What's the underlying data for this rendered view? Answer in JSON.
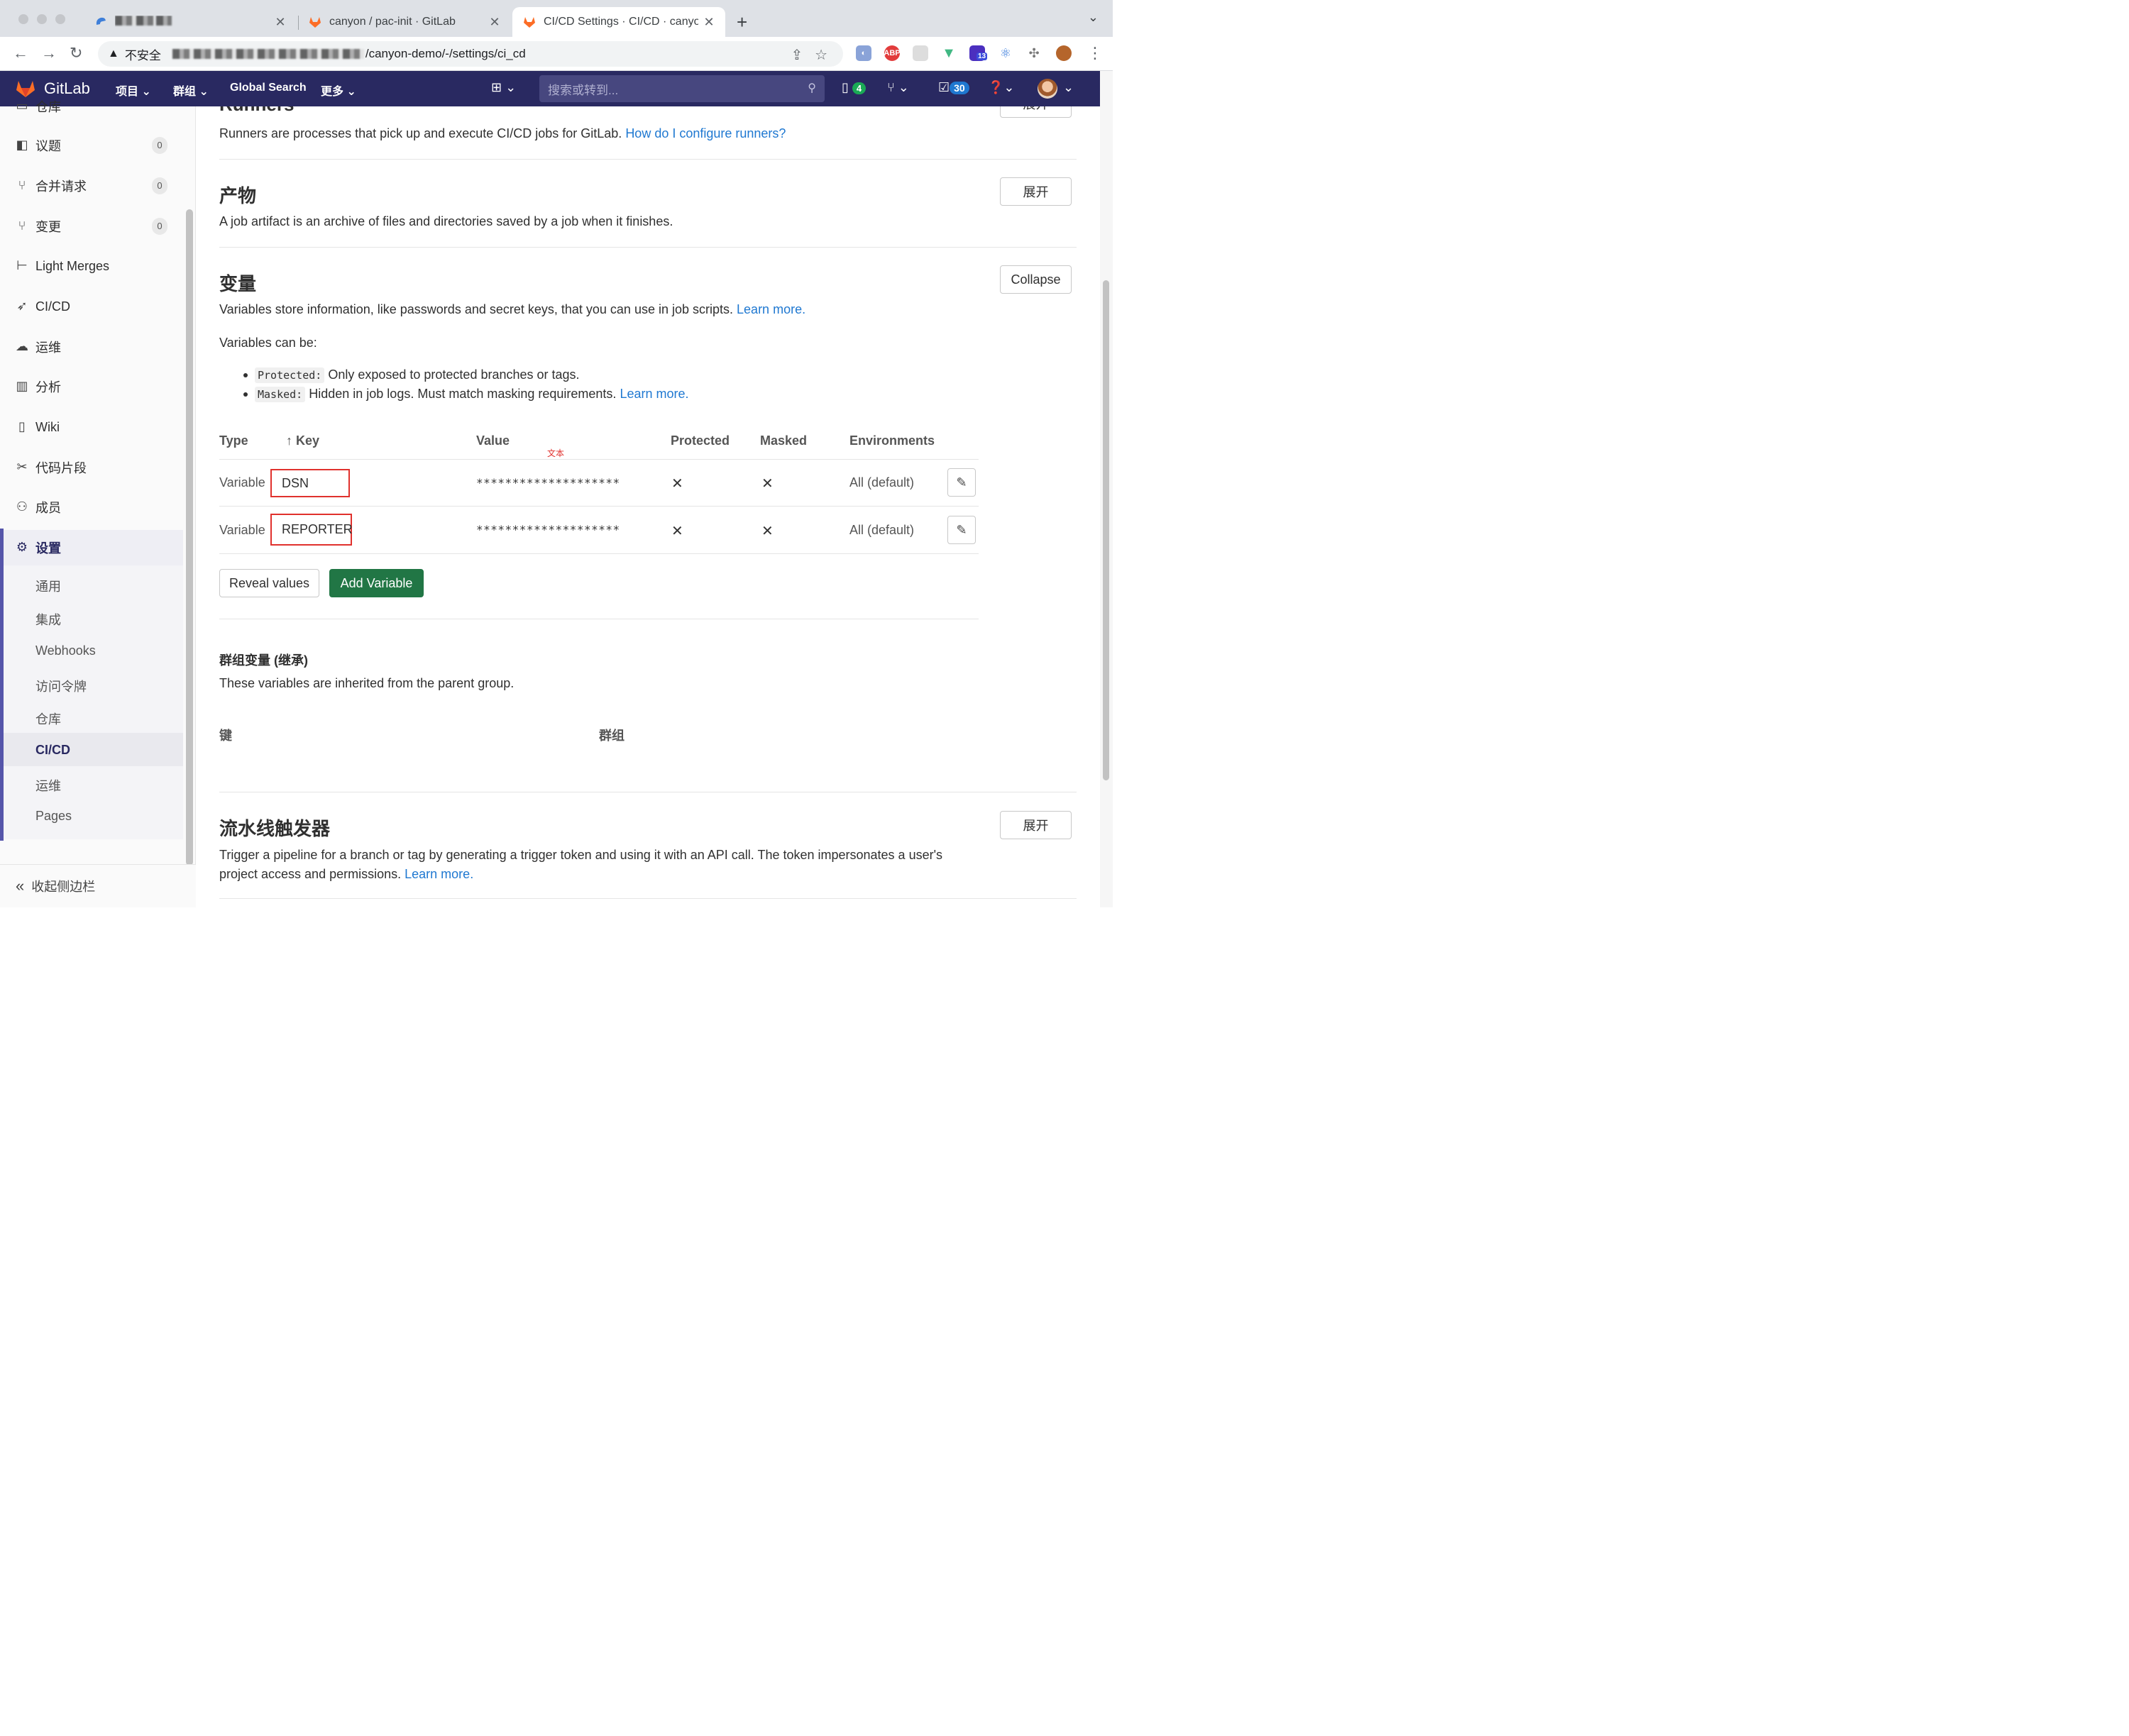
{
  "browser": {
    "tabs": [
      {
        "title": ""
      },
      {
        "title": "canyon / pac-init · GitLab"
      },
      {
        "title": "CI/CD Settings · CI/CD · canyo"
      }
    ],
    "omnibox": {
      "insecure_label": "不安全",
      "url_visible": "/canyon-demo/-/settings/ci_cd"
    },
    "extension_badge": "13"
  },
  "gitlab_nav": {
    "brand": "GitLab",
    "menu": [
      "项目",
      "群组",
      "Global Search",
      "更多"
    ],
    "search_placeholder": "搜索或转到...",
    "issues_count": "4",
    "todos_count": "30"
  },
  "sidebar": {
    "items": [
      {
        "label": "仓库",
        "icon": "book-icon"
      },
      {
        "label": "议题",
        "icon": "issues-icon",
        "count": "0"
      },
      {
        "label": "合并请求",
        "icon": "merge-request-icon",
        "count": "0"
      },
      {
        "label": "变更",
        "icon": "merge-request-icon",
        "count": "0"
      },
      {
        "label": "Light Merges",
        "icon": "tree-icon"
      },
      {
        "label": "CI/CD",
        "icon": "rocket-icon"
      },
      {
        "label": "运维",
        "icon": "cloud-icon"
      },
      {
        "label": "分析",
        "icon": "chart-icon"
      },
      {
        "label": "Wiki",
        "icon": "book-icon"
      },
      {
        "label": "代码片段",
        "icon": "scissors-icon"
      },
      {
        "label": "成员",
        "icon": "users-icon"
      },
      {
        "label": "设置",
        "icon": "gear-icon"
      }
    ],
    "settings_sub": [
      "通用",
      "集成",
      "Webhooks",
      "访问令牌",
      "仓库",
      "CI/CD",
      "运维",
      "Pages"
    ],
    "collapse_label": "收起侧边栏"
  },
  "main": {
    "runners": {
      "title": "Runners",
      "button": "展开",
      "desc": "Runners are processes that pick up and execute CI/CD jobs for GitLab.",
      "link": "How do I configure runners?"
    },
    "artifacts": {
      "title": "产物",
      "button": "展开",
      "desc": "A job artifact is an archive of files and directories saved by a job when it finishes."
    },
    "variables": {
      "title": "变量",
      "button": "Collapse",
      "desc": "Variables store information, like passwords and secret keys, that you can use in job scripts.",
      "desc_link": "Learn more.",
      "can_be": "Variables can be:",
      "bullets": [
        {
          "code": "Protected:",
          "text": "Only exposed to protected branches or tags.",
          "link": ""
        },
        {
          "code": "Masked:",
          "text": "Hidden in job logs. Must match masking requirements.",
          "link": "Learn more."
        }
      ],
      "table_headers": {
        "type": "Type",
        "key": "Key",
        "value": "Value",
        "protected": "Protected",
        "masked": "Masked",
        "environments": "Environments"
      },
      "annotation": "文本",
      "rows": [
        {
          "type": "Variable",
          "key": "DSN",
          "value": "********************",
          "protected": "✕",
          "masked": "✕",
          "env": "All (default)"
        },
        {
          "type": "Variable",
          "key": "REPORTER",
          "value": "********************",
          "protected": "✕",
          "masked": "✕",
          "env": "All (default)"
        }
      ],
      "reveal_button": "Reveal values",
      "add_button": "Add Variable"
    },
    "group_vars": {
      "title": "群组变量 (继承)",
      "desc": "These variables are inherited from the parent group.",
      "col_key": "键",
      "col_group": "群组"
    },
    "triggers": {
      "title": "流水线触发器",
      "button": "展开",
      "desc_line1": "Trigger a pipeline for a branch or tag by generating a trigger token and using it with an API call. The token impersonates a user's",
      "desc_line2": "project access and permissions.",
      "link": "Learn more."
    }
  },
  "colors": {
    "nav_bg": "#292961",
    "link": "#1f78d1",
    "add_button": "#217645",
    "annotation_red": "#e0312d"
  }
}
